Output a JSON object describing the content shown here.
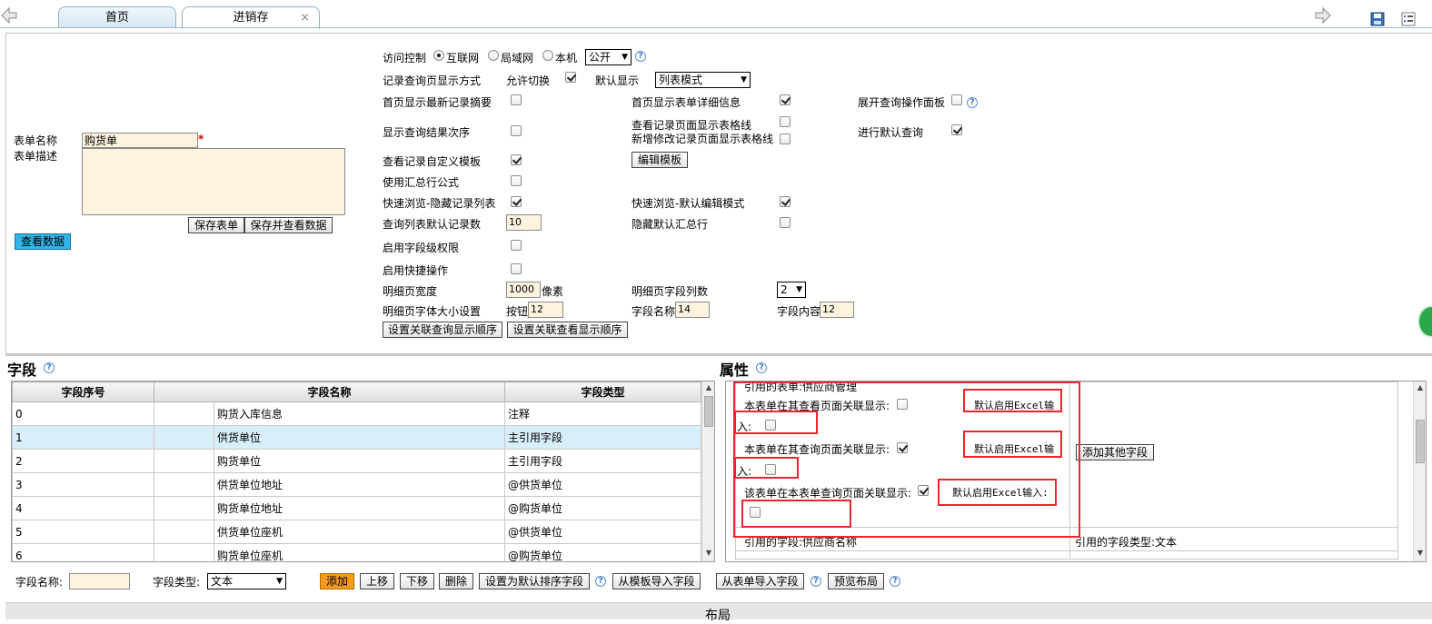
{
  "tabs": [
    {
      "label": "首页"
    },
    {
      "label": "进销存",
      "close": "×"
    }
  ],
  "form": {
    "name_label": "表单名称",
    "name_value": "购货单",
    "required_mark": "*",
    "desc_label": "表单描述",
    "save_label": "保存表单",
    "save_view_label": "保存并查看数据",
    "view_data_label": "查看数据"
  },
  "settings": {
    "access_label": "访问控制",
    "access_options": [
      "互联网",
      "局域网",
      "本机"
    ],
    "access_selected": "互联网",
    "access_select": "公开",
    "display_mode_label": "记录查询页显示方式",
    "allow_switch_label": "允许切换",
    "allow_switch": true,
    "default_display_label": "默认显示",
    "default_display_value": "列表模式",
    "home_latest_label": "首页显示最新记录摘要",
    "home_latest": false,
    "home_detail_label": "首页显示表单详细信息",
    "home_detail": true,
    "expand_panel_label": "展开查询操作面板",
    "expand_panel": false,
    "show_order_label": "显示查询结果次序",
    "show_order": false,
    "view_gridlines_label": "查看记录页面显示表格线",
    "view_gridlines": false,
    "edit_gridlines_label": "新增修改记录页面显示表格线",
    "edit_gridlines": false,
    "default_query_label": "进行默认查询",
    "default_query": true,
    "custom_template_label": "查看记录自定义模板",
    "custom_template": true,
    "edit_template_label": "编辑模板",
    "summary_formula_label": "使用汇总行公式",
    "summary_formula": false,
    "quick_hide_label": "快速浏览-隐藏记录列表",
    "quick_hide": true,
    "quick_edit_label": "快速浏览-默认编辑模式",
    "quick_edit": true,
    "default_count_label": "查询列表默认记录数",
    "default_count": "10",
    "hide_summary_label": "隐藏默认汇总行",
    "hide_summary": false,
    "field_permission_label": "启用字段级权限",
    "field_permission": false,
    "quick_ops_label": "启用快捷操作",
    "quick_ops": false,
    "detail_width_label": "明细页宽度",
    "detail_width": "1000",
    "pixel_unit": "像素",
    "detail_cols_label": "明细页字段列数",
    "detail_cols": "2",
    "font_size_label": "明细页字体大小设置",
    "button_label": "按钮",
    "button_size": "12",
    "field_name_label": "字段名称",
    "field_name_size": "14",
    "field_content_label": "字段内容",
    "field_content_size": "12",
    "rel_query_order_label": "设置关联查询显示顺序",
    "rel_view_order_label": "设置关联查看显示顺序"
  },
  "fields": {
    "title": "字段",
    "headers": [
      "字段序号",
      "字段名称",
      "字段类型"
    ],
    "rows": [
      {
        "no": "0",
        "name": "购货入库信息",
        "type": "注释"
      },
      {
        "no": "1",
        "name": "供货单位",
        "type": "主引用字段"
      },
      {
        "no": "2",
        "name": "购货单位",
        "type": "主引用字段"
      },
      {
        "no": "3",
        "name": "供货单位地址",
        "type": "@供货单位"
      },
      {
        "no": "4",
        "name": "购货单位地址",
        "type": "@购货单位"
      },
      {
        "no": "5",
        "name": "供货单位座机",
        "type": "@供货单位"
      },
      {
        "no": "6",
        "name": "购货单位座机",
        "type": "@购货单位"
      }
    ]
  },
  "properties": {
    "title": "属性",
    "ref_table_text": "引用的表单:供应商管理",
    "view_related_label": "本表单在其查看页面关联显示:",
    "view_related": false,
    "excel_label": "默认启用Excel输",
    "excel_cont": "入:",
    "excel_view": false,
    "query_related_label": "本表单在其查询页面关联显示:",
    "query_related": true,
    "excel_query": false,
    "self_query_label": "该表单在本表单查询页面关联显示:",
    "self_query": true,
    "excel_full_label": "默认启用Excel输入:",
    "excel_self": false,
    "add_other_label": "添加其他字段",
    "ref_field_text": "引用的字段:供应商名称",
    "ref_type_text": "引用的字段类型:文本"
  },
  "bottom": {
    "name_label": "字段名称:",
    "type_label": "字段类型:",
    "type_value": "文本",
    "add_label": "添加",
    "up_label": "上移",
    "down_label": "下移",
    "delete_label": "删除",
    "set_sort_label": "设置为默认排序字段",
    "from_template_label": "从模板导入字段",
    "from_table_label": "从表单导入字段",
    "preview_label": "预览布局",
    "layout_label": "布局"
  }
}
